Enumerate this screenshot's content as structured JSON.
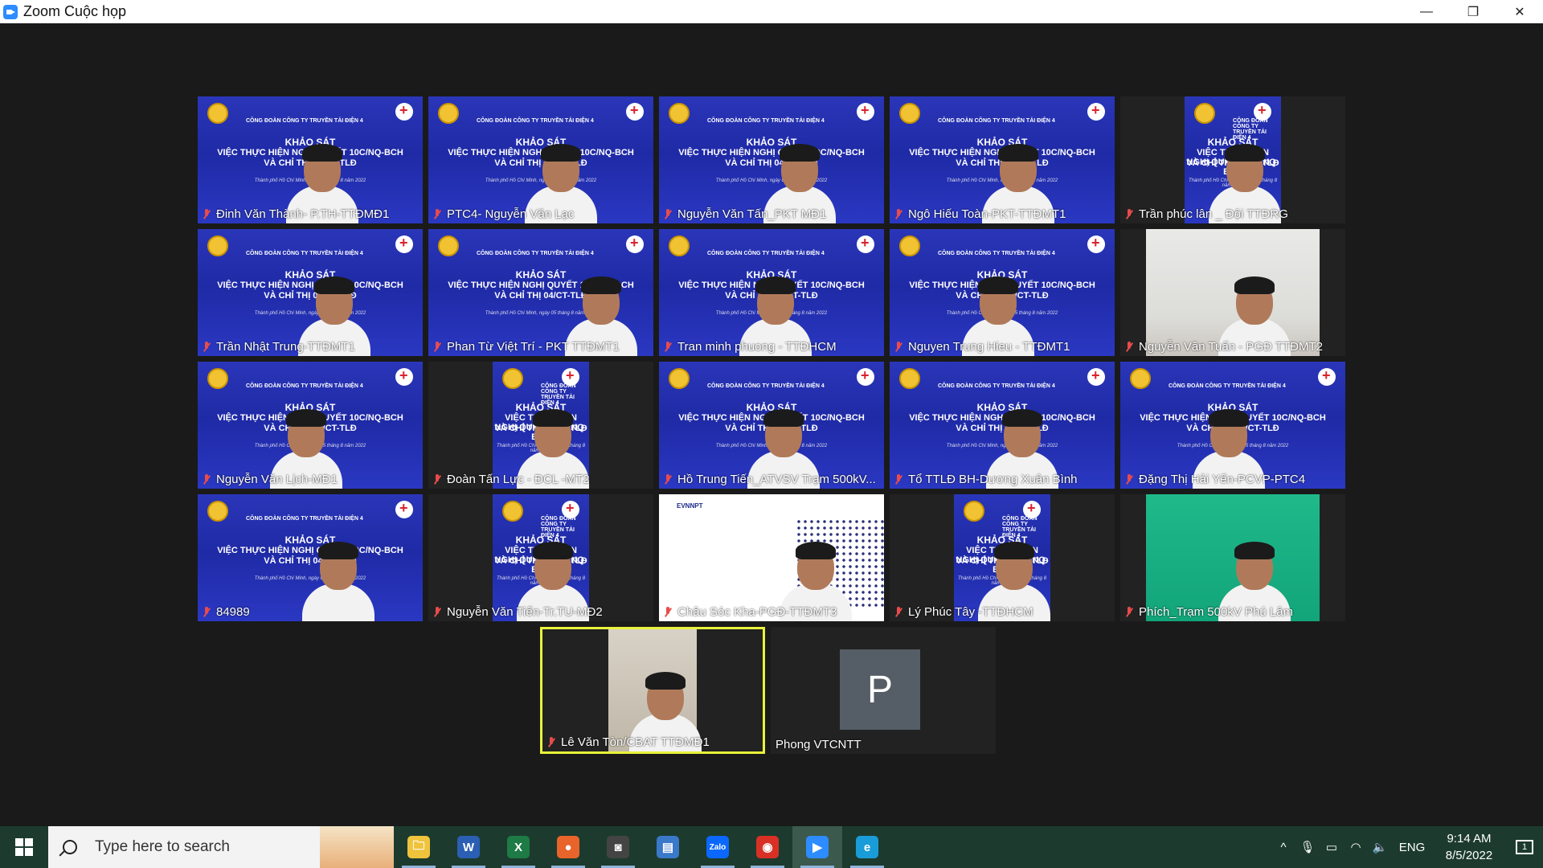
{
  "window": {
    "title": "Zoom Cuộc họp",
    "controls": {
      "minimize": "—",
      "restore": "❐",
      "close": "✕"
    }
  },
  "banner": {
    "org": "CÔNG ĐOÀN CÔNG TY TRUYỀN TẢI ĐIỆN 4",
    "line1": "KHẢO SÁT",
    "line2": "VIỆC THỰC HIỆN NGHỊ QUYẾT 10C/NQ-BCH",
    "line3": "VÀ CHỈ THỊ 04/CT-TLĐ",
    "line4": "Thành phố Hồ Chí Minh, ngày 05 tháng 8 năm 2022",
    "brand": "EVNNPT"
  },
  "participants": [
    {
      "name": "Đinh Văn Thành- P.TH-TTĐMĐ1",
      "muted": true
    },
    {
      "name": "PTC4- Nguyễn Văn Lạc",
      "muted": true
    },
    {
      "name": "Nguyễn Văn Tấn_PKT MĐ1",
      "muted": true
    },
    {
      "name": "Ngô Hiếu Toàn-PKT-TTĐMT1",
      "muted": true
    },
    {
      "name": "Trần phúc lân _ Đội TTĐRG",
      "muted": true
    },
    {
      "name": "Trần Nhật Trung-TTĐMT1",
      "muted": true
    },
    {
      "name": "Phan Từ Việt Trí - PKT TTĐMT1",
      "muted": true
    },
    {
      "name": "Tran minh phuong - TTĐHCM",
      "muted": true
    },
    {
      "name": "Nguyen Trung Hieu - TTĐMT1",
      "muted": true
    },
    {
      "name": "Nguyễn Văn Tuấn - PGĐ TTĐMT2",
      "muted": true
    },
    {
      "name": "Nguyễn Văn Lịch-MĐ1",
      "muted": true
    },
    {
      "name": "Đoàn Tấn Lực - ĐCL -MT2",
      "muted": true
    },
    {
      "name": "Hồ Trung Tiến_ATVSV Trạm 500kV...",
      "muted": true
    },
    {
      "name": "Tổ TTLĐ BH-Dương Xuân Bình",
      "muted": true
    },
    {
      "name": "Đặng Thị Hải Yến-PCVP-PTC4",
      "muted": true
    },
    {
      "name": "84989",
      "muted": true
    },
    {
      "name": "Nguyễn Văn Tiến-Tr.TU-MĐ2",
      "muted": true
    },
    {
      "name": "Châu Sóc Kha-PGĐ-TTĐMT3",
      "muted": true
    },
    {
      "name": "Lý Phúc Tây -TTĐHCM",
      "muted": true
    },
    {
      "name": "Phích_Trạm 500kV Phú Lâm",
      "muted": true
    },
    {
      "name": "Lê Văn Tòn/CBAT TTĐMĐ1",
      "muted": true,
      "active_speaker": true
    },
    {
      "name": "Phong VTCNTT",
      "muted": false,
      "avatar_letter": "P"
    }
  ],
  "taskbar": {
    "search_placeholder": "Type here to search",
    "apps": [
      {
        "icon": "file-explorer-icon",
        "glyph": "🗀",
        "color": "#f0c33c",
        "open": true
      },
      {
        "icon": "word-icon",
        "glyph": "W",
        "color": "#2b5fb4",
        "open": true
      },
      {
        "icon": "excel-icon",
        "glyph": "X",
        "color": "#1e7b45",
        "open": true
      },
      {
        "icon": "firefox-icon",
        "glyph": "●",
        "color": "#e8642b",
        "open": true
      },
      {
        "icon": "camera-app-icon",
        "glyph": "◙",
        "color": "#444",
        "open": true
      },
      {
        "icon": "news-icon",
        "glyph": "▤",
        "color": "#3a78c9",
        "open": false
      },
      {
        "icon": "zalo-icon",
        "glyph": "Zalo",
        "color": "#0a68ff",
        "open": true
      },
      {
        "icon": "chrome-icon",
        "glyph": "◉",
        "color": "#d93025",
        "open": true
      },
      {
        "icon": "zoom-icon",
        "glyph": "▶",
        "color": "#2d8cff",
        "open": true,
        "current": true
      },
      {
        "icon": "edge-icon",
        "glyph": "e",
        "color": "#1a9cd8",
        "open": true
      }
    ],
    "tray": {
      "chevron": "^",
      "lang": "ENG",
      "time": "9:14 AM",
      "date": "8/5/2022",
      "notifications": "1"
    }
  },
  "colors": {
    "active_border": "#e8f23a",
    "muted_icon": "#e94b4b",
    "banner_blue": "#2232b0",
    "taskbar": "#1c3b2e"
  }
}
